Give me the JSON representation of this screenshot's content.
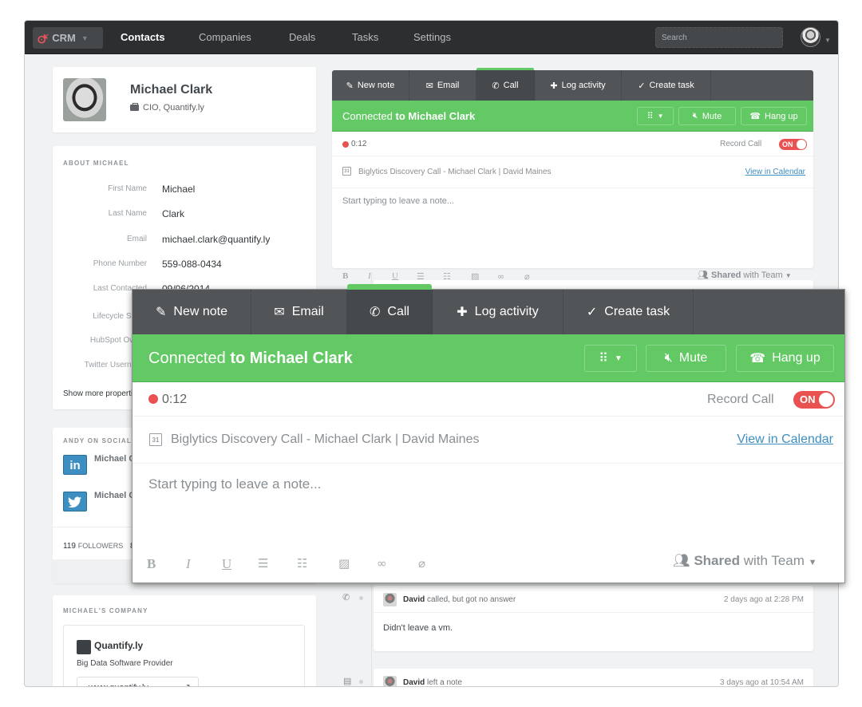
{
  "topnav": {
    "app_label": "CRM",
    "items": [
      "Contacts",
      "Companies",
      "Deals",
      "Tasks",
      "Settings"
    ],
    "active_item": "Contacts",
    "search_placeholder": "Search"
  },
  "contact": {
    "name": "Michael Clark",
    "title": "CIO, Quantify.ly"
  },
  "about": {
    "heading": "ABOUT MICHAEL",
    "properties": [
      {
        "label": "First Name",
        "value": "Michael"
      },
      {
        "label": "Last Name",
        "value": "Clark"
      },
      {
        "label": "Email",
        "value": "michael.clark@quantify.ly"
      },
      {
        "label": "Phone Number",
        "value": "559-088-0434"
      },
      {
        "label": "Last Contacted",
        "value": "09/06/2014"
      },
      {
        "label": "Lifecycle Stage",
        "value": ""
      },
      {
        "label": "HubSpot Owner",
        "value": ""
      },
      {
        "label": "Twitter Username",
        "value": ""
      }
    ],
    "show_more": "Show more properties"
  },
  "social": {
    "heading": "ANDY ON SOCIAL",
    "accounts": [
      {
        "network": "linkedin",
        "icon": "in",
        "handle": "Michael Clark"
      },
      {
        "network": "twitter",
        "icon": "🐦",
        "handle": "Michael Clark"
      }
    ],
    "followers_count": "119",
    "followers_label": "FOLLOWERS",
    "following_count": "8"
  },
  "company": {
    "heading": "MICHAEL'S COMPANY",
    "name": "Quantify.ly",
    "description": "Big Data Software Provider",
    "website": "www.quantify.ly"
  },
  "composer": {
    "tabs": [
      {
        "label": "New note",
        "icon": "✎"
      },
      {
        "label": "Email",
        "icon": "✉"
      },
      {
        "label": "Call",
        "icon": "✆"
      },
      {
        "label": "Log activity",
        "icon": "✚"
      },
      {
        "label": "Create task",
        "icon": "✓"
      }
    ],
    "active_tab": "Call",
    "connected_prefix": "Connected",
    "connected_rest": "to Michael Clark",
    "keypad_icon": "⠿",
    "mute_label": "Mute",
    "hangup_label": "Hang up",
    "timer": "0:12",
    "record_label": "Record Call",
    "record_toggle": "ON",
    "meeting": "Biglytics Discovery Call - Michael Clark | David Maines",
    "calendar_day": "31",
    "calendar_link": "View in Calendar",
    "note_placeholder": "Start typing to leave a note...",
    "format_tools": [
      "B",
      "I",
      "U",
      "bulleted-list",
      "numbered-list",
      "image",
      "link",
      "attachment"
    ],
    "shared_bold": "Shared",
    "shared_rest": "with Team"
  },
  "timeline": [
    {
      "icon": "call-missed",
      "author": "David",
      "action": "called, but got no answer",
      "time": "2 days ago at 2:28 PM",
      "body": "Didn't leave a vm."
    },
    {
      "icon": "note",
      "author": "David",
      "action": "left a note",
      "time": "3 days ago at 10:54 AM",
      "body": ""
    }
  ]
}
